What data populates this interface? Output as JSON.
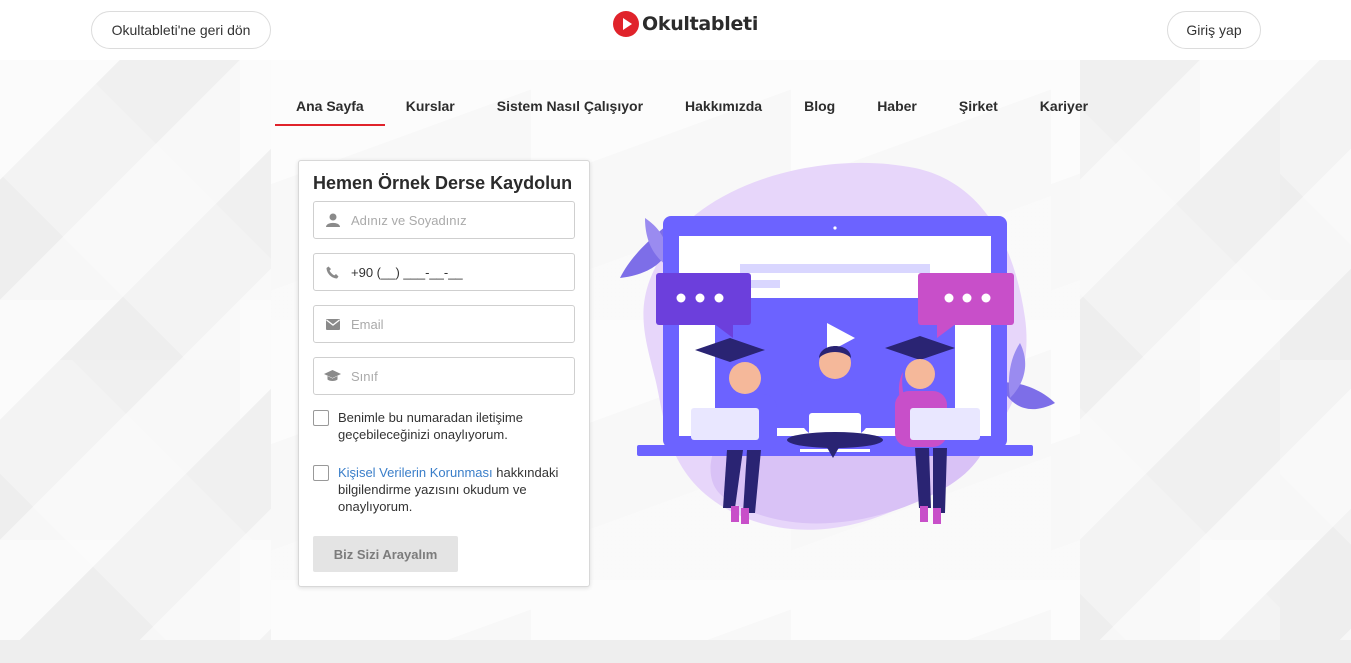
{
  "header": {
    "back_label": "Okultableti'ne geri dön",
    "logo_text": "Okultableti",
    "login_label": "Giriş yap"
  },
  "nav": {
    "items": [
      {
        "label": "Ana Sayfa",
        "active": true
      },
      {
        "label": "Kurslar"
      },
      {
        "label": "Sistem Nasıl Çalışıyor"
      },
      {
        "label": "Hakkımızda"
      },
      {
        "label": "Blog"
      },
      {
        "label": "Haber"
      },
      {
        "label": "Şirket"
      },
      {
        "label": "Kariyer"
      }
    ]
  },
  "form": {
    "title": "Hemen Örnek Derse Kaydolun",
    "name_placeholder": "Adınız ve Soyadınız",
    "phone_value": "+90 (__) ___-__-__",
    "email_placeholder": "Email",
    "grade_placeholder": "Sınıf",
    "consent_contact": "Benimle bu numaradan iletişime geçebileceğinizi onaylıyorum.",
    "kvkk_link": "Kişisel Verilerin Korunması",
    "kvkk_rest": " hakkındaki bilgilendirme yazısını okudum ve onaylıyorum.",
    "submit_label": "Biz Sizi Arayalım"
  },
  "colors": {
    "brand_red": "#e0232b",
    "link_blue": "#3a7ec9",
    "illustration_purple": "#6c63ff",
    "illustration_pink": "#c84fc9"
  },
  "icons": [
    "user-icon",
    "phone-icon",
    "envelope-icon",
    "graduation-cap-icon"
  ]
}
